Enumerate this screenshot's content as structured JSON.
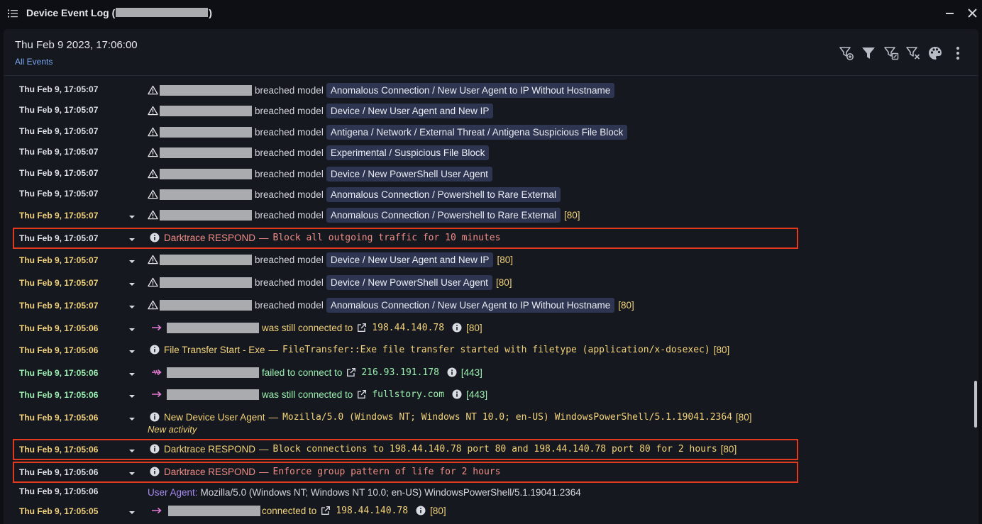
{
  "window": {
    "title_prefix": "Device Event Log (",
    "title_suffix": ")"
  },
  "header": {
    "date": "Thu Feb 9 2023, 17:06:00",
    "filter_link": "All Events"
  },
  "colors": {
    "accent": "#7ba7ee",
    "highlight_border": "#e23a1f",
    "model_tag_bg": "#2d3551",
    "respond_text": "#f08c86",
    "new_text": "#f2d27a",
    "green_text": "#9af0b0"
  },
  "icons": {
    "menu": "list-icon",
    "minimize": "minimize-icon",
    "close": "close-icon",
    "tools": [
      "filter-add-icon",
      "filter-icon",
      "filter-edit-icon",
      "filter-remove-icon",
      "palette-icon",
      "more-vertical-icon"
    ]
  },
  "events": [
    {
      "time": "Thu Feb 9, 17:05:07",
      "action": "breached model",
      "model": "Anomalous Connection / New User Agent to IP Without Hostname"
    },
    {
      "time": "Thu Feb 9, 17:05:07",
      "action": "breached model",
      "model": "Device / New User Agent and New IP"
    },
    {
      "time": "Thu Feb 9, 17:05:07",
      "action": "breached model",
      "model": "Antigena / Network / External Threat / Antigena Suspicious File Block"
    },
    {
      "time": "Thu Feb 9, 17:05:07",
      "action": "breached model",
      "model": "Experimental / Suspicious File Block"
    },
    {
      "time": "Thu Feb 9, 17:05:07",
      "action": "breached model",
      "model": "Device / New PowerShell User Agent"
    },
    {
      "time": "Thu Feb 9, 17:05:07",
      "action": "breached model",
      "model": "Anomalous Connection / Powershell to Rare External"
    },
    {
      "time": "Thu Feb 9, 17:05:07",
      "action": "breached model",
      "model": "Anomalous Connection / Powershell to Rare External",
      "suffix": "[80]"
    },
    {
      "time": "Thu Feb 9, 17:05:07",
      "label": "Darktrace RESPOND",
      "separator": "—",
      "detail": "Block all outgoing traffic for 10 minutes"
    },
    {
      "time": "Thu Feb 9, 17:05:07",
      "action": "breached model",
      "model": "Device / New User Agent and New IP",
      "suffix": "[80]"
    },
    {
      "time": "Thu Feb 9, 17:05:07",
      "action": "breached model",
      "model": "Device / New PowerShell User Agent",
      "suffix": "[80]"
    },
    {
      "time": "Thu Feb 9, 17:05:07",
      "action": "breached model",
      "model": "Anomalous Connection / New User Agent to IP Without Hostname",
      "suffix": "[80]"
    },
    {
      "time": "Thu Feb 9, 17:05:06",
      "action": "was still connected to",
      "target": "198.44.140.78",
      "suffix": "[80]"
    },
    {
      "time": "Thu Feb 9, 17:05:06",
      "label": "File Transfer Start - Exe",
      "separator": "—",
      "detail": "FileTransfer::Exe file transfer started with filetype (application/x-dosexec)",
      "suffix": "[80]"
    },
    {
      "time": "Thu Feb 9, 17:05:06",
      "action": "failed to connect to",
      "target": "216.93.191.178",
      "suffix": "[443]"
    },
    {
      "time": "Thu Feb 9, 17:05:06",
      "action": "was still connected to",
      "target": "fullstory.com",
      "suffix": "[443]"
    },
    {
      "time": "Thu Feb 9, 17:05:06",
      "label": "New Device User Agent",
      "separator": "—",
      "detail": "Mozilla/5.0 (Windows NT; Windows NT 10.0; en-US) WindowsPowerShell/5.1.19041.2364",
      "suffix": "[80]",
      "note": "New activity"
    },
    {
      "time": "Thu Feb 9, 17:05:06",
      "label": "Darktrace RESPOND",
      "separator": "—",
      "detail": "Block connections to 198.44.140.78 port 80 and 198.44.140.78 port 80 for 2 hours",
      "suffix": "[80]"
    },
    {
      "time": "Thu Feb 9, 17:05:06",
      "label": "Darktrace RESPOND",
      "separator": "—",
      "detail": "Enforce group pattern of life for 2 hours"
    },
    {
      "time": "Thu Feb 9, 17:05:06",
      "label": "User Agent:",
      "detail": "Mozilla/5.0 (Windows NT; Windows NT 10.0; en-US) WindowsPowerShell/5.1.19041.2364"
    },
    {
      "time": "Thu Feb 9, 17:05:05",
      "action": "connected to",
      "target": "198.44.140.78",
      "suffix": "[80]"
    }
  ]
}
